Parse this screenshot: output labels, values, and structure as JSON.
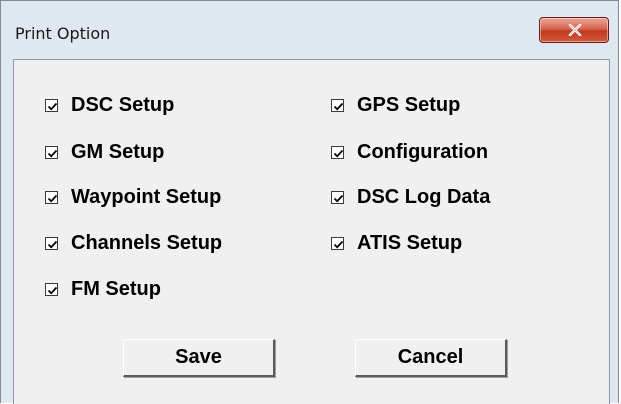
{
  "window": {
    "title": "Print Option",
    "close_glyph": "X"
  },
  "options_left": [
    {
      "label": "DSC Setup",
      "checked": true
    },
    {
      "label": "GM Setup",
      "checked": true
    },
    {
      "label": "Waypoint Setup",
      "checked": true
    },
    {
      "label": "Channels Setup",
      "checked": true
    },
    {
      "label": "FM Setup",
      "checked": true
    }
  ],
  "options_right": [
    {
      "label": "GPS Setup",
      "checked": true
    },
    {
      "label": "Configuration",
      "checked": true
    },
    {
      "label": "DSC Log Data",
      "checked": true
    },
    {
      "label": "ATIS Setup",
      "checked": true
    }
  ],
  "buttons": {
    "save": "Save",
    "cancel": "Cancel"
  },
  "colors": {
    "close_button": "#c94a32",
    "frame": "#dfe7f1",
    "client": "#f0f0f0"
  },
  "icons": {
    "close": "close-icon",
    "check": "checkmark-icon"
  }
}
